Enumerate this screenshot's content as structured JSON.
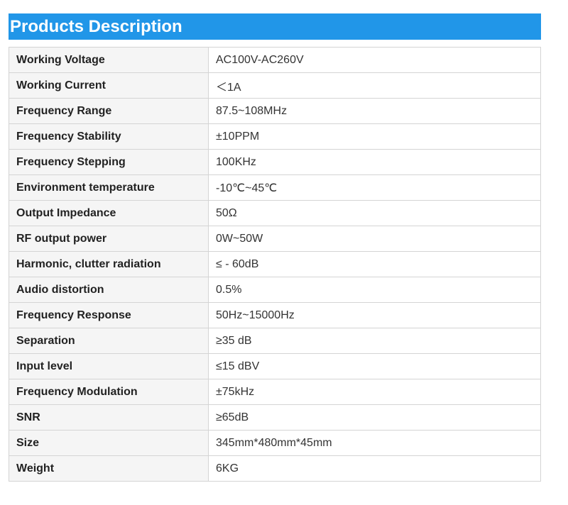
{
  "title": "Products Description",
  "rows": [
    {
      "label": "Working Voltage",
      "value": "AC100V-AC260V"
    },
    {
      "label": "Working Current",
      "value": "＜1A"
    },
    {
      "label": "Frequency Range",
      "value": "87.5~108MHz"
    },
    {
      "label": "Frequency Stability",
      "value": "±10PPM"
    },
    {
      "label": "Frequency Stepping",
      "value": "100KHz"
    },
    {
      "label": "Environment temperature",
      "value": "-10℃~45℃"
    },
    {
      "label": "Output Impedance",
      "value": "50Ω"
    },
    {
      "label": "RF output power",
      "value": "0W~50W"
    },
    {
      "label": "Harmonic, clutter radiation",
      "value": "≤ - 60dB"
    },
    {
      "label": "Audio distortion",
      "value": "0.5%"
    },
    {
      "label": "Frequency Response",
      "value": "50Hz~15000Hz"
    },
    {
      "label": "Separation",
      "value": "≥35 dB"
    },
    {
      "label": "Input level",
      "value": "≤15 dBV"
    },
    {
      "label": "Frequency Modulation",
      "value": "±75kHz"
    },
    {
      "label": "SNR",
      "value": "≥65dB"
    },
    {
      "label": "Size",
      "value": "345mm*480mm*45mm"
    },
    {
      "label": "Weight",
      "value": "6KG"
    }
  ]
}
